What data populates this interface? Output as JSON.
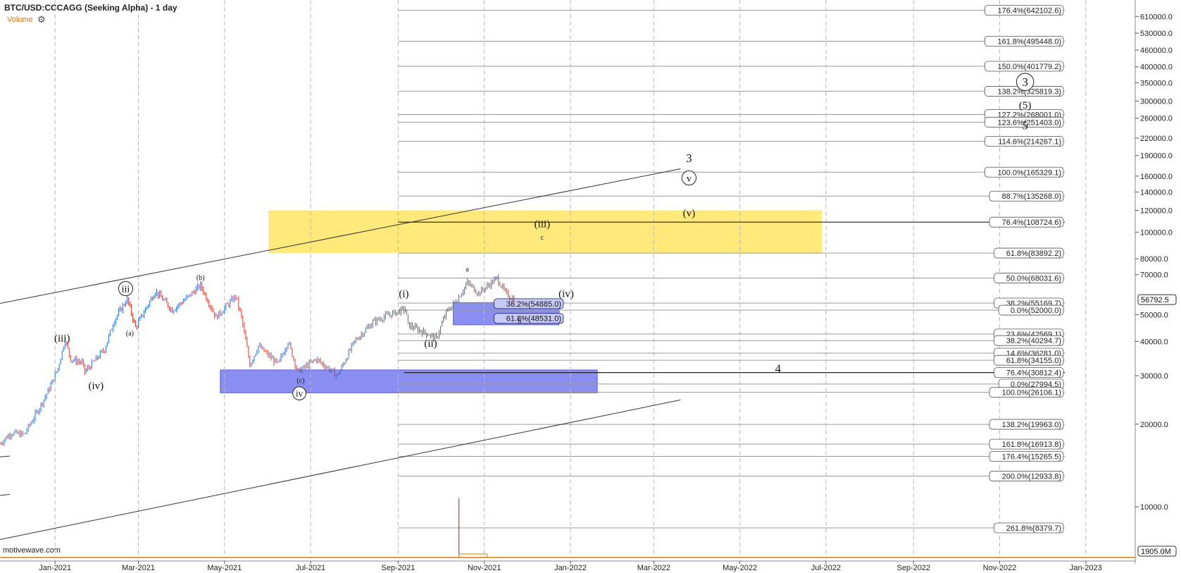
{
  "header": {
    "title": "BTC/USD:CCCAGG (Seeking Alpha) - 1 day",
    "volume_label": "Volume",
    "volume_color": "#e07800"
  },
  "watermark": "motivewave.com",
  "chart_data": {
    "type": "ohlc-candlestick",
    "scale": "log",
    "ylim": [
      6500,
      700000
    ],
    "xlim": [
      "2020-11-23",
      "2023-02-05"
    ],
    "x_ticks": [
      "Jan-2021",
      "Mar-2021",
      "May-2021",
      "Jul-2021",
      "Sep-2021",
      "Nov-2021",
      "Jan-2022",
      "Mar-2022",
      "May-2022",
      "Jul-2022",
      "Sep-2022",
      "Nov-2022",
      "Jan-2023"
    ],
    "x_tick_dates": [
      "2021-01-01",
      "2021-03-01",
      "2021-05-01",
      "2021-07-01",
      "2021-09-01",
      "2021-11-01",
      "2022-01-01",
      "2022-03-01",
      "2022-05-01",
      "2022-07-01",
      "2022-09-01",
      "2022-11-01",
      "2023-01-01"
    ],
    "y_ticks": [
      {
        "label": "610000.0",
        "v": 610000
      },
      {
        "label": "530000.0",
        "v": 530000
      },
      {
        "label": "460000.0",
        "v": 460000
      },
      {
        "label": "400000.0",
        "v": 400000
      },
      {
        "label": "350000.0",
        "v": 350000
      },
      {
        "label": "300000.0",
        "v": 300000
      },
      {
        "label": "260000.0",
        "v": 260000
      },
      {
        "label": "220000.0",
        "v": 220000
      },
      {
        "label": "190000.0",
        "v": 190000
      },
      {
        "label": "160000.0",
        "v": 160000
      },
      {
        "label": "140000.0",
        "v": 140000
      },
      {
        "label": "120000.0",
        "v": 120000
      },
      {
        "label": "100000.0",
        "v": 100000
      },
      {
        "label": "80000.0",
        "v": 80000
      },
      {
        "label": "70000.0",
        "v": 70000
      },
      {
        "label": "50000.0",
        "v": 50000
      },
      {
        "label": "40000.0",
        "v": 40000
      },
      {
        "label": "30000.0",
        "v": 30000
      },
      {
        "label": "20000.0",
        "v": 20000
      },
      {
        "label": "10000.0",
        "v": 10000
      }
    ],
    "last_price_label": "56792.5",
    "last_price": 56792.5,
    "volume_scale_label": "1905.0M",
    "price_points": [
      [
        "2020-11-23",
        17000
      ],
      [
        "2020-12-01",
        18600
      ],
      [
        "2020-12-10",
        18300
      ],
      [
        "2020-12-20",
        22500
      ],
      [
        "2020-12-28",
        27000
      ],
      [
        "2021-01-03",
        32000
      ],
      [
        "2021-01-08",
        40500
      ],
      [
        "2021-01-12",
        34500
      ],
      [
        "2021-01-20",
        33500
      ],
      [
        "2021-01-22",
        31000
      ],
      [
        "2021-01-29",
        34000
      ],
      [
        "2021-02-05",
        37500
      ],
      [
        "2021-02-12",
        48000
      ],
      [
        "2021-02-21",
        57000
      ],
      [
        "2021-02-27",
        45000
      ],
      [
        "2021-03-13",
        61000
      ],
      [
        "2021-03-25",
        52000
      ],
      [
        "2021-04-05",
        58000
      ],
      [
        "2021-04-14",
        64000
      ],
      [
        "2021-04-25",
        49000
      ],
      [
        "2021-05-09",
        58500
      ],
      [
        "2021-05-13",
        49000
      ],
      [
        "2021-05-19",
        33000
      ],
      [
        "2021-05-25",
        38500
      ],
      [
        "2021-06-08",
        33000
      ],
      [
        "2021-06-15",
        40000
      ],
      [
        "2021-06-22",
        31000
      ],
      [
        "2021-07-05",
        34500
      ],
      [
        "2021-07-20",
        30000
      ],
      [
        "2021-08-01",
        40000
      ],
      [
        "2021-08-14",
        47000
      ],
      [
        "2021-08-23",
        49500
      ],
      [
        "2021-09-06",
        52500
      ],
      [
        "2021-09-08",
        46000
      ],
      [
        "2021-09-20",
        43000
      ],
      [
        "2021-09-28",
        41000
      ],
      [
        "2021-10-05",
        51000
      ],
      [
        "2021-10-14",
        58000
      ],
      [
        "2021-10-20",
        65500
      ],
      [
        "2021-10-28",
        60000
      ],
      [
        "2021-11-10",
        68000
      ],
      [
        "2021-11-16",
        60000
      ],
      [
        "2021-11-22",
        56800
      ]
    ],
    "fib_lines_right": [
      {
        "label": "176.4%(642102.6)",
        "v": 642102.6
      },
      {
        "label": "161.8%(495448.0)",
        "v": 495448.0
      },
      {
        "label": "150.0%(401779.2)",
        "v": 401779.2
      },
      {
        "label": "138.2%(325819.3)",
        "v": 325819.3
      },
      {
        "label": "127.2%(268001.0)",
        "v": 268001.0
      },
      {
        "label": "123.6%(251403.0)",
        "v": 251403.0
      },
      {
        "label": "114.6%(214267.1)",
        "v": 214267.1
      },
      {
        "label": "100.0%(165329.1)",
        "v": 165329.1
      },
      {
        "label": "88.7%(135268.0)",
        "v": 135268.0
      },
      {
        "label": "61.8%(83892.2)",
        "v": 83892.2
      },
      {
        "label": "50.0%(68031.6)",
        "v": 68031.6
      },
      {
        "label": "38.2%(55169.7)",
        "v": 55169.7
      },
      {
        "label": "0.0%(52000.0)",
        "v": 52000.0
      },
      {
        "label": "23.6%(42569.1)",
        "v": 42569.1
      },
      {
        "label": "38.2%(40294.7)",
        "v": 40294.7
      },
      {
        "label": "14.6%(36281.0)",
        "v": 36281.0
      },
      {
        "label": "61.8%(34155.0)",
        "v": 34155.0
      },
      {
        "label": "0.0%(27994.5)",
        "v": 27994.5
      },
      {
        "label": "100.0%(26106.1)",
        "v": 26106.1
      },
      {
        "label": "138.2%(19963.0)",
        "v": 19963.0
      },
      {
        "label": "161.8%(16913.8)",
        "v": 16913.8
      },
      {
        "label": "176.4%(15265.5)",
        "v": 15265.5
      },
      {
        "label": "200.0%(12933.8)",
        "v": 12933.8
      },
      {
        "label": "261.8%(8379.7)",
        "v": 8379.7
      }
    ],
    "key_lines": [
      {
        "label": "76.4%(108724.6)",
        "v": 108724.6,
        "start": "2021-09-01"
      },
      {
        "label": "76.4%(30812.4)",
        "v": 30812.4,
        "start": "2021-09-05"
      }
    ],
    "blue_fibs": [
      {
        "label": "38.2%(54885.0)",
        "v": 54885.0
      },
      {
        "label": "61.8%(48531.0)",
        "v": 48531.0
      }
    ],
    "zones": [
      {
        "color": "#ffe97a",
        "x0": "2021-06-01",
        "x1": "2022-06-28",
        "y0": 84000,
        "y1": 120000
      },
      {
        "color": "#8a8ef0",
        "x0": "2021-04-28",
        "x1": "2022-01-20",
        "y0": 26000,
        "y1": 31500
      },
      {
        "color": "#8a8ef0",
        "x0": "2021-10-10",
        "x1": "2021-12-24",
        "y0": 46000,
        "y1": 55400
      }
    ],
    "channel_lines": [
      {
        "x0": "2020-11-23",
        "y0": 55000,
        "x1": "2022-03-20",
        "y1": 170000
      },
      {
        "x0": "2020-11-23",
        "y0": 7600,
        "x1": "2022-03-20",
        "y1": 24500
      },
      {
        "x0": "2020-11-23",
        "y0": 15200,
        "x1": "2020-11-30",
        "y1": 15300
      },
      {
        "x0": "2020-11-23",
        "y0": 11000,
        "x1": "2020-11-30",
        "y1": 11100
      }
    ],
    "wave_labels": [
      {
        "text": "(iii)",
        "d": "2021-01-06",
        "v": 40000,
        "size": 15
      },
      {
        "text": "(iv)",
        "d": "2021-01-30",
        "v": 26800,
        "size": 15
      },
      {
        "text": "iii",
        "d": "2021-02-20",
        "v": 60500,
        "size": 14,
        "circle": true
      },
      {
        "text": "(a)",
        "d": "2021-02-23",
        "v": 42000,
        "size": 10
      },
      {
        "text": "(b)",
        "d": "2021-04-14",
        "v": 67000,
        "size": 10
      },
      {
        "text": "(c)",
        "d": "2021-06-24",
        "v": 28300,
        "size": 10
      },
      {
        "text": "iv",
        "d": "2021-06-23",
        "v": 25200,
        "size": 13,
        "circle": true
      },
      {
        "text": "(i)",
        "d": "2021-09-05",
        "v": 58000,
        "size": 15
      },
      {
        "text": "(ii)",
        "d": "2021-09-24",
        "v": 38300,
        "size": 15
      },
      {
        "text": "a",
        "d": "2021-10-20",
        "v": 72000,
        "size": 10
      },
      {
        "text": "b",
        "d": "2021-11-26",
        "v": 46500,
        "size": 10
      },
      {
        "text": "(iv)",
        "d": "2021-12-29",
        "v": 58000,
        "size": 15
      },
      {
        "text": "(iii)",
        "d": "2021-12-12",
        "v": 104000,
        "size": 15
      },
      {
        "text": "c",
        "d": "2021-12-12",
        "v": 94000,
        "size": 10
      },
      {
        "text": "(v)",
        "d": "2022-03-26",
        "v": 114000,
        "size": 15
      },
      {
        "text": "v",
        "d": "2022-03-26",
        "v": 153000,
        "size": 14,
        "circle": true
      },
      {
        "text": "3",
        "d": "2022-03-26",
        "v": 180000,
        "size": 17
      },
      {
        "text": "4",
        "d": "2022-05-28",
        "v": 30800,
        "size": 17
      },
      {
        "text": "3",
        "d": "2022-11-19",
        "v": 340000,
        "size": 17,
        "circle": true
      },
      {
        "text": "(5)",
        "d": "2022-11-19",
        "v": 282000,
        "size": 15
      },
      {
        "text": "5",
        "d": "2022-11-19",
        "v": 237000,
        "size": 17
      }
    ],
    "volume_spike": {
      "d": "2021-10-14",
      "value_fraction": 0.98
    }
  }
}
